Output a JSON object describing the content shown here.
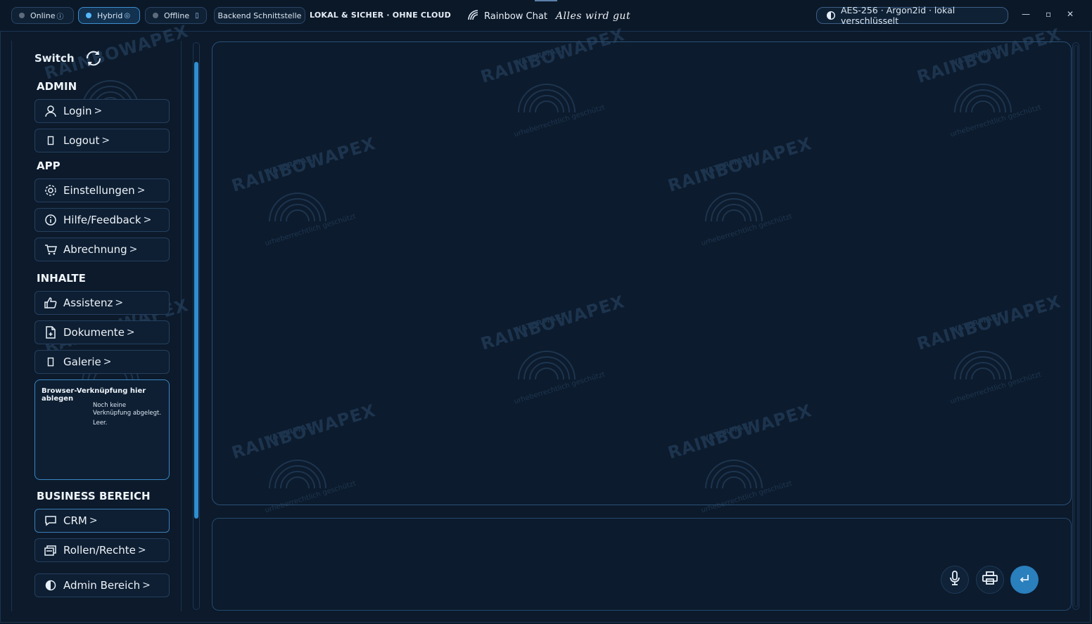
{
  "titlebar": {
    "modes": [
      {
        "label": "Online",
        "suffix": "ⓘ"
      },
      {
        "label": "Hybrid",
        "suffix": "◎"
      },
      {
        "label": "Offline",
        "suffix": "▯"
      }
    ],
    "backend_label": "Backend Schnittstelle",
    "local_label": "LOKAL & SICHER · OHNE CLOUD",
    "app_title": "Rainbow Chat",
    "slogan": "Alles wird gut",
    "security_label": "AES-256 · Argon2id · lokal verschlüsselt",
    "window_controls": {
      "minimize": "—",
      "maximize": "▫",
      "close": "✕"
    }
  },
  "sidebar": {
    "switch_label": "Switch",
    "sections": {
      "admin": "ADMIN",
      "app": "APP",
      "inhalte": "INHALTE",
      "business": "BUSINESS BEREICH"
    },
    "items": {
      "login": "Login",
      "logout": "Logout",
      "einstellungen": "Einstellungen",
      "hilfe": "Hilfe/Feedback",
      "abrechnung": "Abrechnung",
      "assistenz": "Assistenz",
      "dokumente": "Dokumente",
      "galerie": "Galerie",
      "crm": "CRM",
      "rollen": "Rollen/Rechte",
      "admin_bereich": "Admin Bereich"
    },
    "chevron": ">",
    "dropzone": {
      "title": "Browser-Verknüpfung hier ablegen",
      "line1": "Noch keine",
      "line2": "Verknüpfung abgelegt.",
      "line3": "Leer."
    }
  },
  "watermark": {
    "brand": "RAINBOWAPEX",
    "top": "WATERMARK",
    "sub": "urheberrechtlich geschützt"
  },
  "icons": [
    "wifi-icon",
    "shield-icon",
    "sync-icon",
    "user-icon",
    "settings-icon",
    "info-icon",
    "cart-icon",
    "thumbs-up-icon",
    "document-icon",
    "chat-icon",
    "roles-icon",
    "mic-icon",
    "print-icon",
    "send-icon"
  ],
  "colors": {
    "accent": "#2f8ecf",
    "background": "#0c1a2b",
    "panel_border": "#2a5177"
  }
}
